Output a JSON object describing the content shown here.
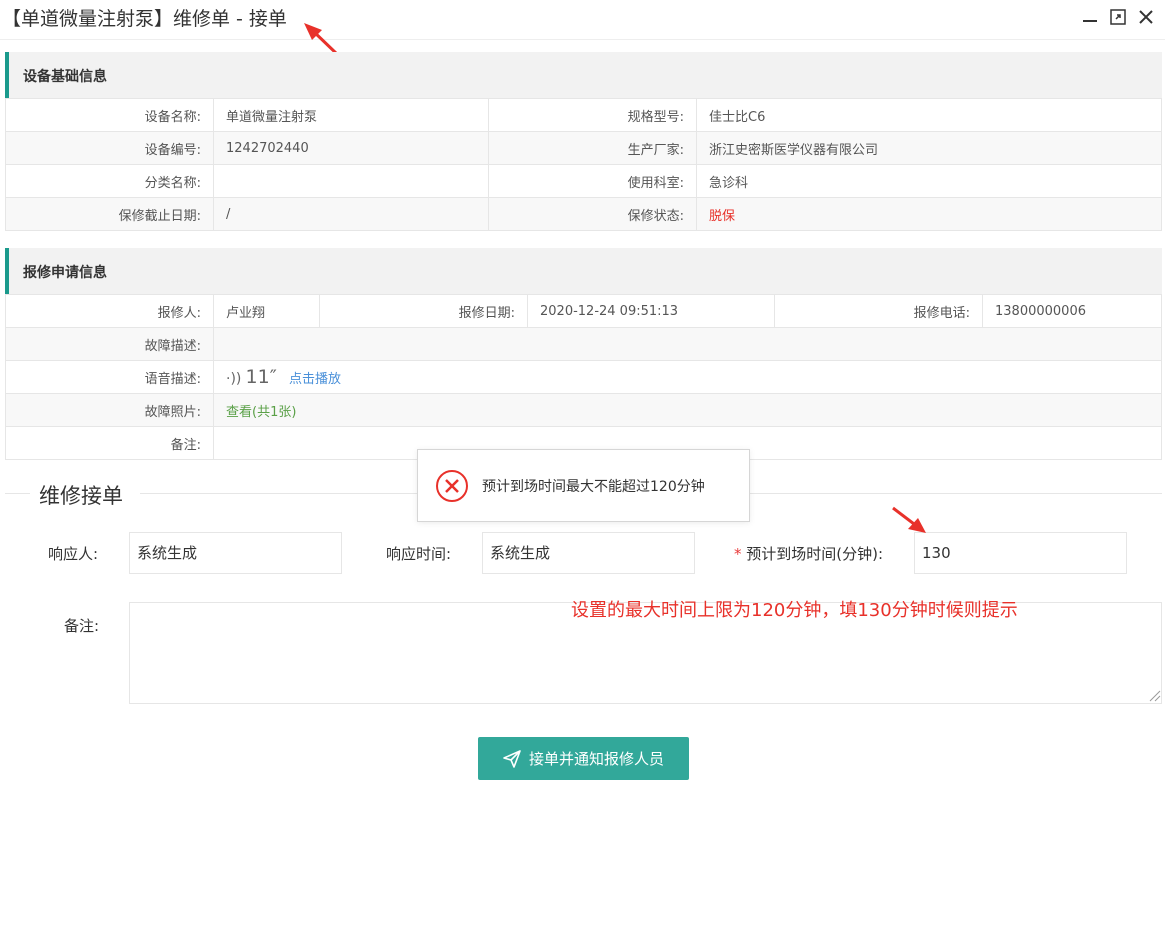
{
  "window": {
    "title": "【单道微量注射泵】维修单 - 接单",
    "minimize_icon": "minimize-icon",
    "maximize_icon": "maximize-icon",
    "close_icon": "close-icon"
  },
  "equipment": {
    "heading": "设备基础信息",
    "rows": [
      {
        "l1": "设备名称:",
        "v1": "单道微量注射泵",
        "l2": "规格型号:",
        "v2": "佳士比C6"
      },
      {
        "l1": "设备编号:",
        "v1": "1242702440",
        "l2": "生产厂家:",
        "v2": "浙江史密斯医学仪器有限公司"
      },
      {
        "l1": "分类名称:",
        "v1": "",
        "l2": "使用科室:",
        "v2": "急诊科"
      },
      {
        "l1": "保修截止日期:",
        "v1": "/",
        "l2": "保修状态:",
        "v2": "脱保"
      }
    ],
    "status_color": "#e8312a"
  },
  "request": {
    "heading": "报修申请信息",
    "reporter_label": "报修人:",
    "reporter": "卢业翔",
    "date_label": "报修日期:",
    "date": "2020-12-24 09:51:13",
    "phone_label": "报修电话:",
    "phone": "13800000006",
    "fault_label": "故障描述:",
    "fault": "",
    "voice_label": "语音描述:",
    "voice_duration": "11″",
    "voice_play": "点击播放",
    "photo_label": "故障照片:",
    "photo_link": "查看(共1张)",
    "remark_label": "备注:",
    "remark": ""
  },
  "form": {
    "legend": "维修接单",
    "responder_label": "响应人:",
    "responder_value": "系统生成",
    "response_time_label": "响应时间:",
    "response_time_value": "系统生成",
    "required_mark": "*",
    "eta_label": "预计到场时间(分钟):",
    "eta_value": "130",
    "remark_label": "备注:",
    "remark_value": "",
    "submit_label": "接单并通知报修人员"
  },
  "toast": {
    "icon": "error-circle-icon",
    "message": "预计到场时间最大不能超过120分钟"
  },
  "annotation": {
    "text": "设置的最大时间上限为120分钟，填130分钟时候则提示"
  },
  "colors": {
    "accent": "#1a9a8c",
    "button": "#32a89a",
    "link_blue": "#4a90d9",
    "link_green": "#5aa047",
    "error": "#e8312a"
  }
}
